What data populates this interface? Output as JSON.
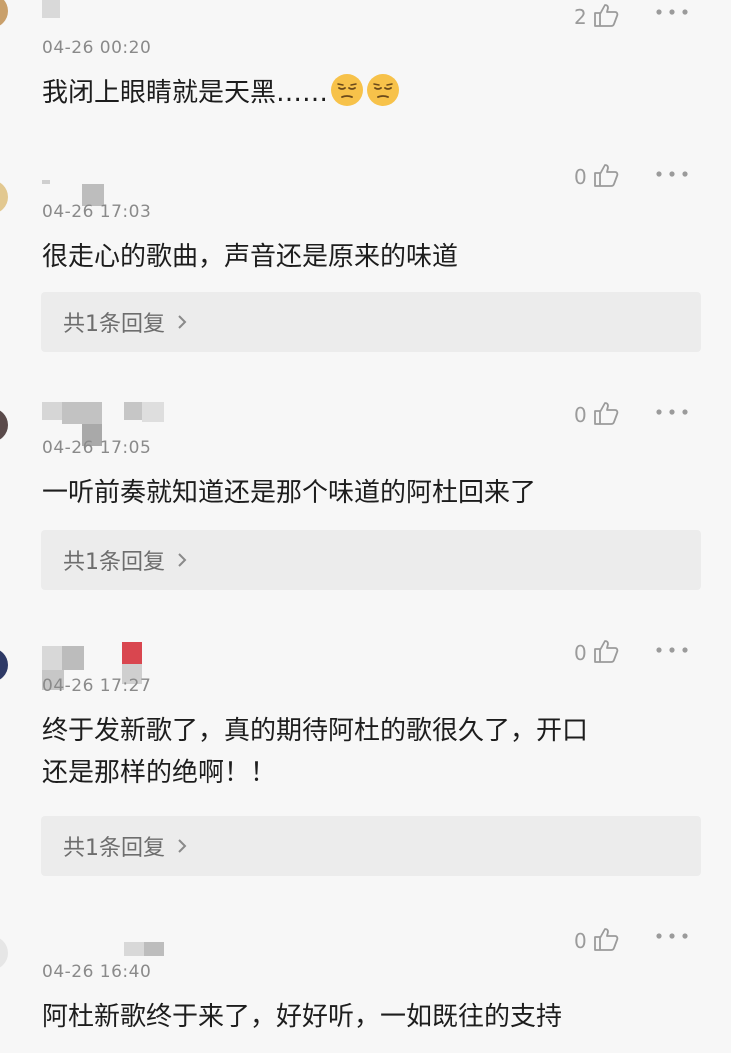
{
  "reply_label": "共1条回复",
  "comments": [
    {
      "time": "04-26 00:20",
      "likes": "2",
      "text": "我闭上眼睛就是天黑……",
      "emoji": [
        "pensive-face",
        "pensive-face"
      ],
      "reply": ""
    },
    {
      "time": "04-26 17:03",
      "likes": "0",
      "text": "很走心的歌曲，声音还是原来的味道",
      "reply": "共1条回复"
    },
    {
      "time": "04-26 17:05",
      "likes": "0",
      "text": "一听前奏就知道还是那个味道的阿杜回来了",
      "reply": "共1条回复"
    },
    {
      "time": "04-26 17:27",
      "likes": "0",
      "text_line1": "终于发新歌了，真的期待阿杜的歌很久了，开口",
      "text_line2": "还是那样的绝啊！！",
      "reply": "共1条回复"
    },
    {
      "time": "04-26 16:40",
      "likes": "0",
      "text": "阿杜新歌终于来了，好好听，一如既往的支持",
      "reply": ""
    }
  ],
  "colors": {
    "background": "#f7f7f7",
    "reply_bg": "#ececec",
    "meta_text": "#8a8a8a",
    "icon": "#a0a0a0"
  }
}
